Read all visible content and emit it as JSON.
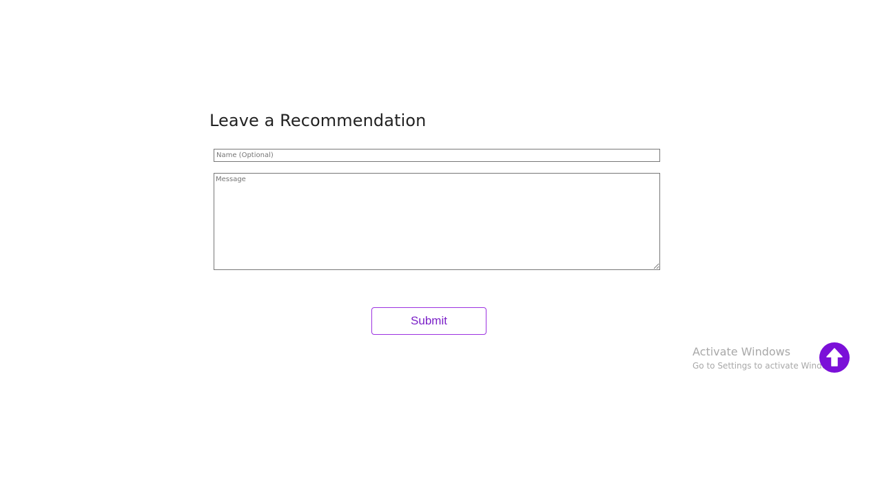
{
  "form": {
    "title": "Leave a Recommendation",
    "name_placeholder": "Name (Optional)",
    "name_value": "",
    "message_placeholder": "Message",
    "message_value": "",
    "submit_label": "Submit"
  },
  "os_watermark": {
    "title": "Activate Windows",
    "subtitle": "Go to Settings to activate Windows."
  },
  "scroll_top": {
    "icon": "arrow-up-icon"
  },
  "colors": {
    "accent": "#7b10d8",
    "button_border": "#9b30e0",
    "button_text": "#7a1fc7"
  }
}
